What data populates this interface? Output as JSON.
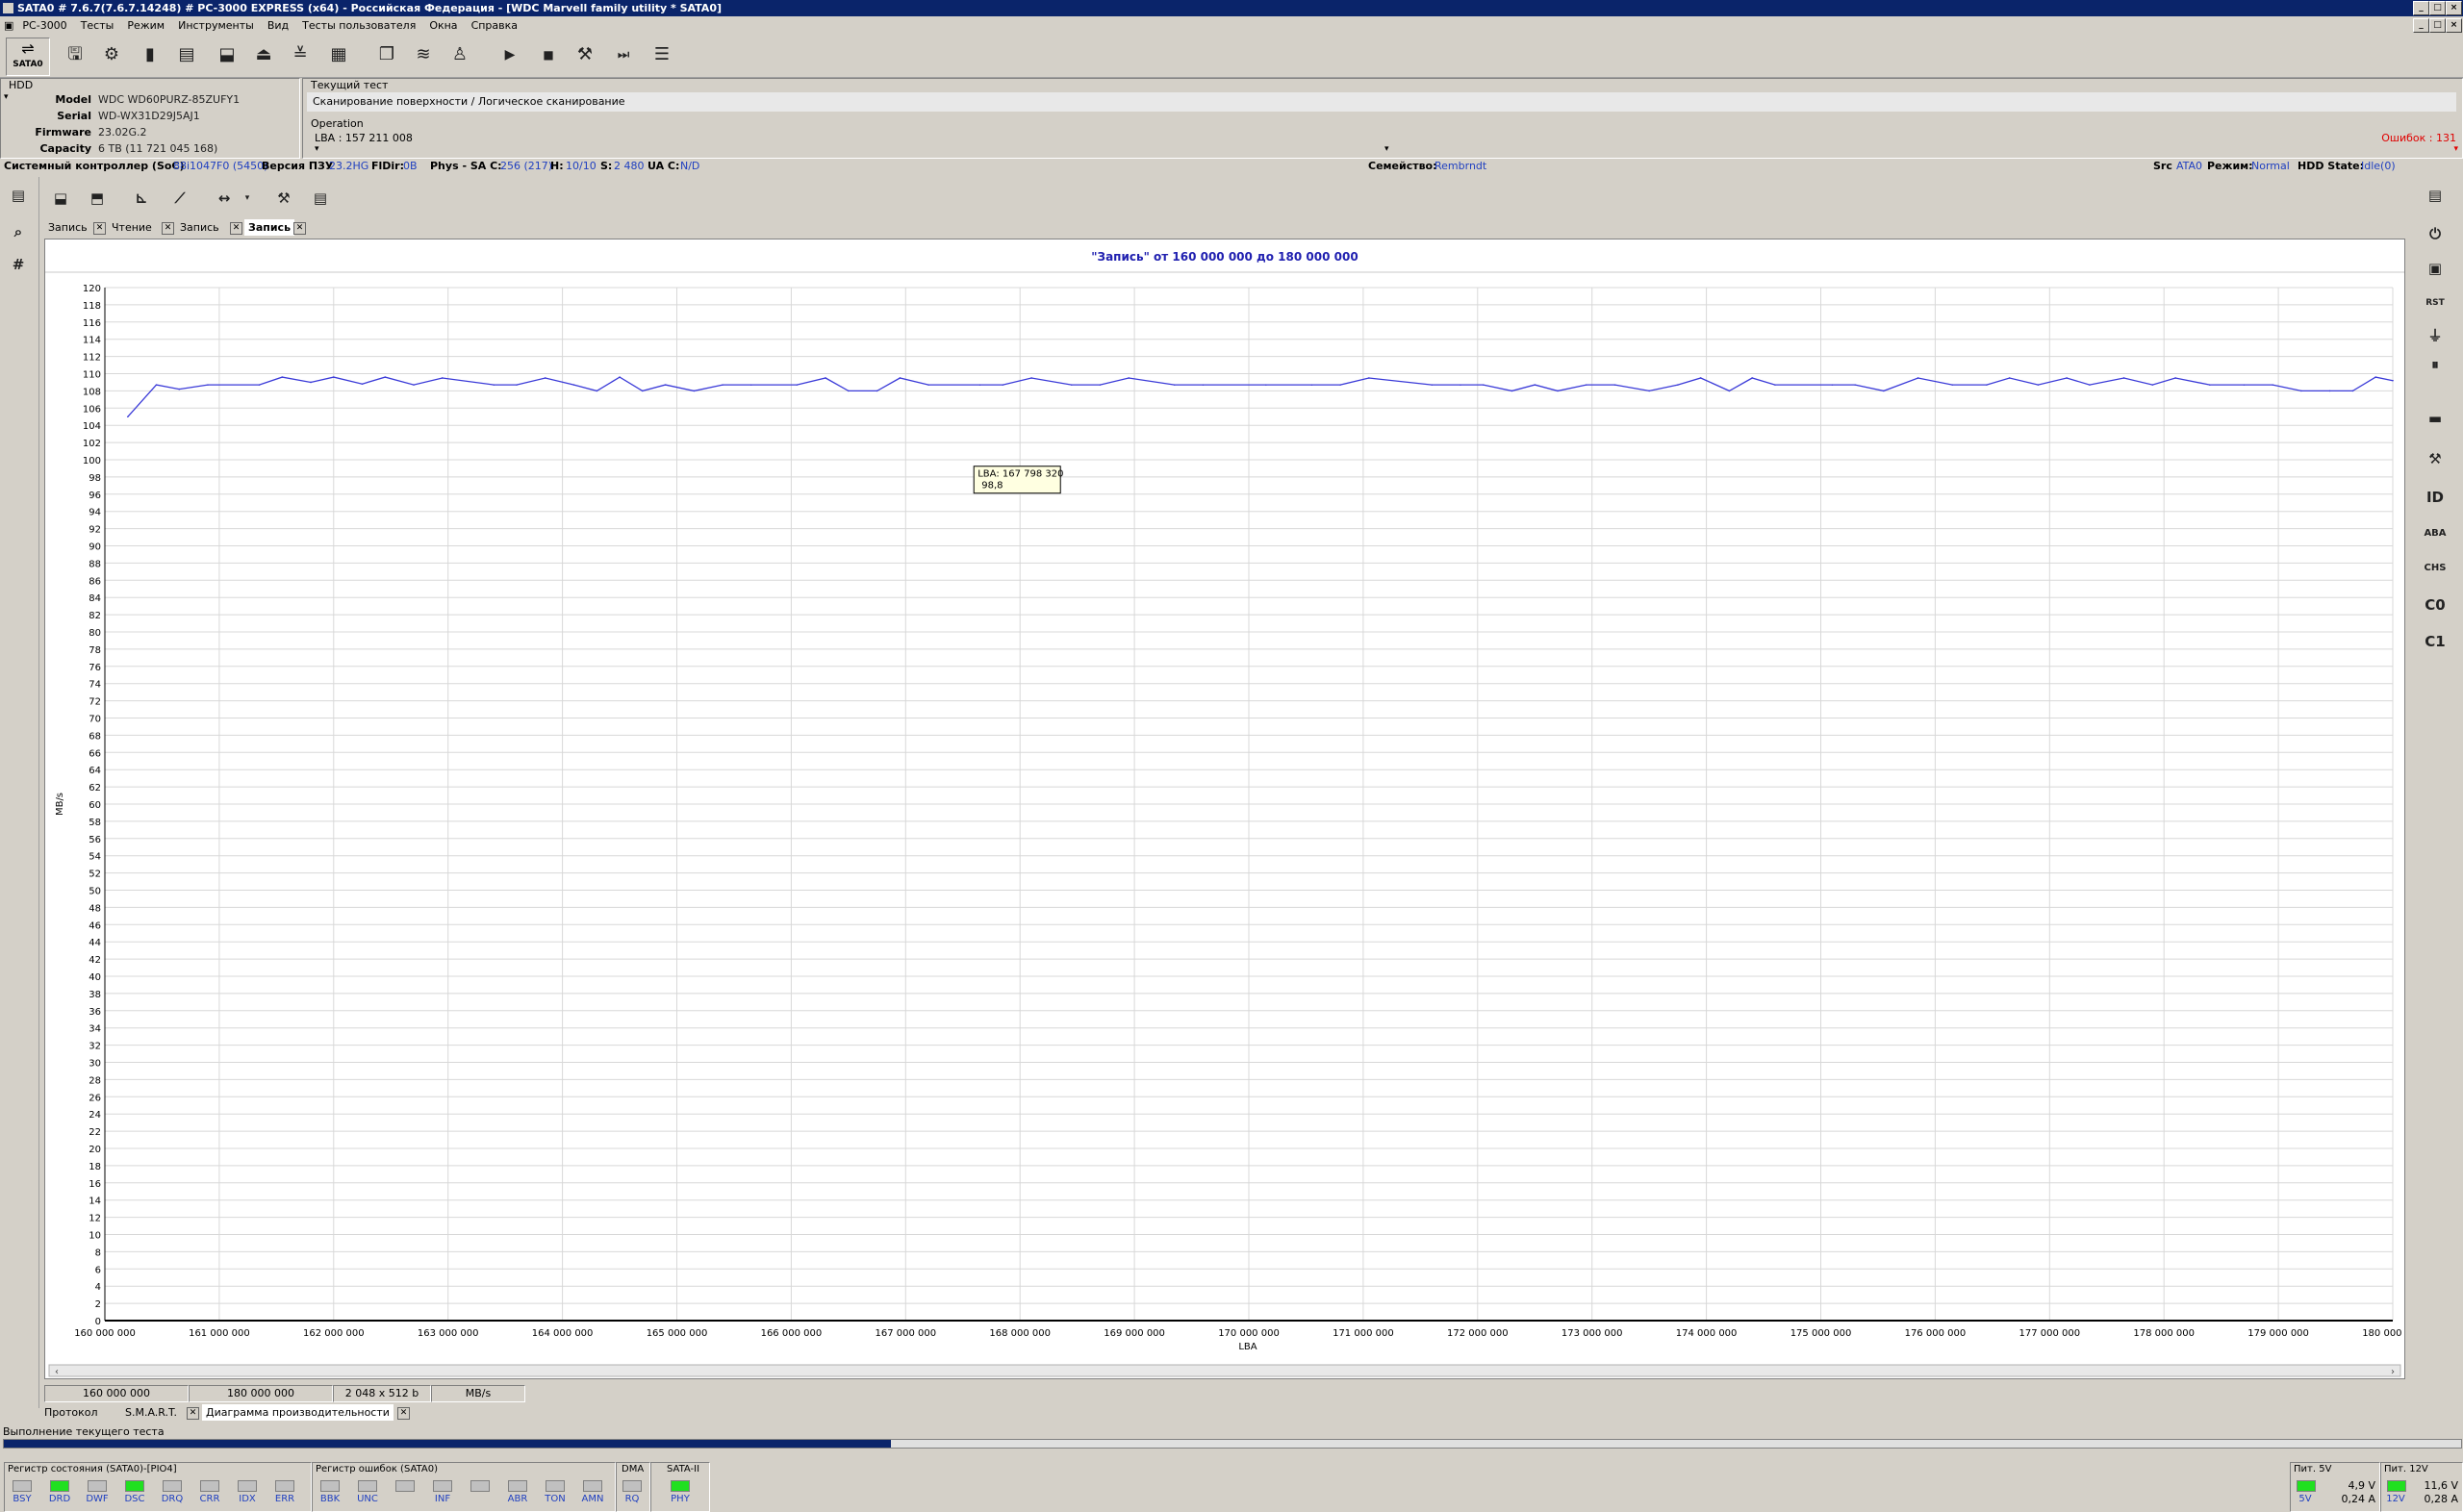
{
  "window": {
    "title": "SATA0 # 7.6.7(7.6.7.14248) # PC-3000 EXPRESS (x64) - Российская Федерация - [WDC Marvell family utility * SATA0]"
  },
  "menu": [
    "PC-3000",
    "Тесты",
    "Режим",
    "Инструменты",
    "Вид",
    "Тесты пользователя",
    "Окна",
    "Справка"
  ],
  "toolbar": {
    "port_label": "SATA0"
  },
  "hdd": {
    "header": "HDD",
    "model_label": "Model",
    "model": "WDC WD60PURZ-85ZUFY1",
    "serial_label": "Serial",
    "serial": "WD-WX31D29J5AJ1",
    "firmware_label": "Firmware",
    "firmware": "23.02G.2",
    "capacity_label": "Capacity",
    "capacity": "6 TB (11 721 045 168)"
  },
  "current_test": {
    "header": "Текущий тест",
    "name": "Сканирование поверхности / Логическое сканирование",
    "operation_label": "Operation",
    "lba": "LBA : 157 211 008",
    "errors": "Ошибок : 131"
  },
  "infoline": {
    "soc_label": "Системный контроллер (SoC)",
    "soc": "88i1047F0 (5450)",
    "rom_label": "Версия ПЗУ",
    "rom": "23.2HG",
    "fldir_label": "FlDir:",
    "fldir": "0B",
    "phys_label": "Phys - SA C:",
    "phys": "256 (217)",
    "h_label": "H:",
    "h": "10/10",
    "s_label": "S:",
    "s": "2 480",
    "ua_label": "UA C:",
    "ua": "N/D",
    "family_label": "Семейство:",
    "family": "Rembrndt",
    "src_label": "Src",
    "src": "ATA0",
    "mode_label": "Режим:",
    "mode": "Normal",
    "state_label": "HDD State:",
    "state": "Idle(0)"
  },
  "doc_tabs": [
    {
      "label": "Запись",
      "active": false
    },
    {
      "label": "Чтение",
      "active": false
    },
    {
      "label": "Запись",
      "active": false
    },
    {
      "label": "Запись",
      "active": true
    }
  ],
  "chart_data": {
    "type": "line",
    "title": "\"Запись\" от 160 000 000 до 180 000 000",
    "xlabel": "LBA",
    "ylabel": "MB/s",
    "xlim": [
      160000000,
      180000000
    ],
    "ylim": [
      0,
      120
    ],
    "y_ticks": [
      0,
      2,
      4,
      6,
      8,
      10,
      12,
      14,
      16,
      18,
      20,
      22,
      24,
      26,
      28,
      30,
      32,
      34,
      36,
      38,
      40,
      42,
      44,
      46,
      48,
      50,
      52,
      54,
      56,
      58,
      60,
      62,
      64,
      66,
      68,
      70,
      72,
      74,
      76,
      78,
      80,
      82,
      84,
      86,
      88,
      90,
      92,
      94,
      96,
      98,
      100,
      102,
      104,
      106,
      108,
      110,
      112,
      114,
      116,
      118,
      120
    ],
    "x_tick_labels": [
      "160 000 000",
      "161 000 000",
      "162 000 000",
      "163 000 000",
      "164 000 000",
      "165 000 000",
      "166 000 000",
      "167 000 000",
      "168 000 000",
      "169 000 000",
      "170 000 000",
      "171 000 000",
      "172 000 000",
      "173 000 000",
      "174 000 000",
      "175 000 000",
      "176 000 000",
      "177 000 000",
      "178 000 000",
      "179 000 000",
      "180 000 000"
    ],
    "grid": true,
    "series": [
      {
        "color": "#3a3ad8",
        "x": [
          160200000,
          160450000,
          160650000,
          160900000,
          161350000,
          161550000,
          161800000,
          162000000,
          162250000,
          162450000,
          162700000,
          162950000,
          163400000,
          163600000,
          163850000,
          164100000,
          164300000,
          164500000,
          164700000,
          164900000,
          165150000,
          165400000,
          165650000,
          166050000,
          166300000,
          166500000,
          166750000,
          166950000,
          167200000,
          167650000,
          167850000,
          168100000,
          168450000,
          168700000,
          168950000,
          169350000,
          169600000,
          170150000,
          170550000,
          170800000,
          171050000,
          171600000,
          171850000,
          172050000,
          172300000,
          172500000,
          172700000,
          172950000,
          173200000,
          173500000,
          173750000,
          173950000,
          174200000,
          174400000,
          174600000,
          175100000,
          175300000,
          175550000,
          175850000,
          176150000,
          176450000,
          176650000,
          176900000,
          177150000,
          177350000,
          177650000,
          177900000,
          178100000,
          178400000,
          178700000,
          178950000,
          179200000,
          179450000,
          179650000,
          179850000,
          180000000
        ],
        "y": [
          105,
          108.7,
          108.2,
          108.7,
          108.7,
          109.6,
          109,
          109.6,
          108.8,
          109.6,
          108.7,
          109.5,
          108.7,
          108.7,
          109.5,
          108.7,
          108,
          109.6,
          108,
          108.7,
          108,
          108.7,
          108.7,
          108.7,
          109.5,
          108,
          108,
          109.5,
          108.7,
          108.7,
          108.7,
          109.5,
          108.7,
          108.7,
          109.5,
          108.7,
          108.7,
          108.7,
          108.7,
          108.7,
          109.5,
          108.7,
          108.7,
          108.7,
          108,
          108.7,
          108,
          108.7,
          108.7,
          108,
          108.7,
          109.5,
          108,
          109.5,
          108.7,
          108.7,
          108.7,
          108,
          109.5,
          108.7,
          108.7,
          109.5,
          108.7,
          109.5,
          108.7,
          109.5,
          108.7,
          109.5,
          108.7,
          108.7,
          108.7,
          108,
          108,
          108,
          109.6,
          109.2
        ]
      }
    ],
    "tooltip": {
      "lba": "LBA: 167 798 320",
      "value": "98,8",
      "x": 167798320,
      "y": 98.8
    }
  },
  "range_status": {
    "from": "160 000 000",
    "to": "180 000 000",
    "block": "2 048 x 512 b",
    "unit": "MB/s"
  },
  "bottom_tabs": [
    {
      "label": "Протокол",
      "active": false
    },
    {
      "label": "S.M.A.R.T.",
      "active": false
    },
    {
      "label": "Диаграмма производительности",
      "active": true
    }
  ],
  "progress": {
    "label": "Выполнение текущего теста",
    "fraction": 0.361
  },
  "status_register": {
    "title": "Регистр состояния (SATA0)-[PIO4]",
    "leds": [
      {
        "label": "BSY",
        "on": false
      },
      {
        "label": "DRD",
        "on": true
      },
      {
        "label": "DWF",
        "on": false
      },
      {
        "label": "DSC",
        "on": true
      },
      {
        "label": "DRQ",
        "on": false
      },
      {
        "label": "CRR",
        "on": false
      },
      {
        "label": "IDX",
        "on": false
      },
      {
        "label": "ERR",
        "on": false
      }
    ]
  },
  "error_register": {
    "title": "Регистр ошибок (SATA0)",
    "leds": [
      {
        "label": "BBK",
        "on": false
      },
      {
        "label": "UNC",
        "on": false
      },
      {
        "label": "",
        "on": false
      },
      {
        "label": "INF",
        "on": false
      },
      {
        "label": "",
        "on": false
      },
      {
        "label": "ABR",
        "on": false
      },
      {
        "label": "TON",
        "on": false
      },
      {
        "label": "AMN",
        "on": false
      }
    ]
  },
  "dma": {
    "title": "DMA",
    "led": {
      "label": "RQ",
      "on": false
    }
  },
  "sata": {
    "title": "SATA-II",
    "led": {
      "label": "PHY",
      "on": true
    }
  },
  "power5": {
    "title": "Пит. 5V",
    "label": "5V",
    "volts": "4,9 V",
    "amps": "0,24 A"
  },
  "power12": {
    "title": "Пит. 12V",
    "label": "12V",
    "volts": "11,6 V",
    "amps": "0,28 A"
  }
}
